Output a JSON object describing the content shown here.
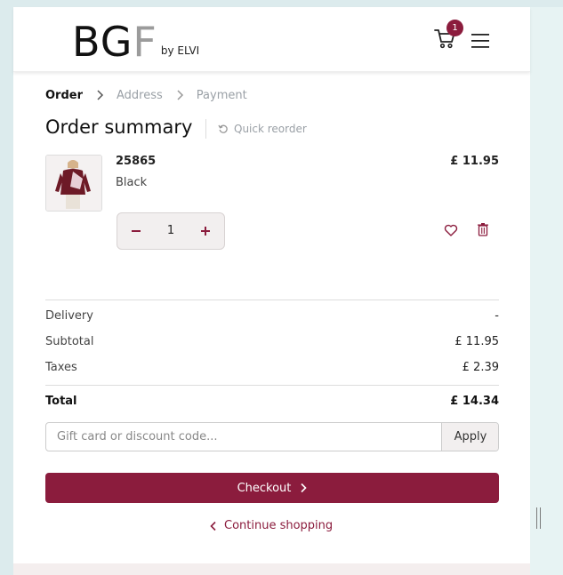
{
  "header": {
    "logo_main": "BG",
    "logo_f": "F",
    "logo_sub": "by ELVI",
    "cart_count": "1",
    "menu_icon": "hamburger-icon",
    "cart_icon": "cart-icon"
  },
  "breadcrumb": {
    "step1": "Order",
    "step2": "Address",
    "step3": "Payment"
  },
  "summary": {
    "title": "Order summary",
    "quick_reorder": "Quick reorder"
  },
  "product": {
    "name": "25865",
    "variant": "Black",
    "price": "£ 11.95",
    "quantity": "1"
  },
  "totals": {
    "delivery_label": "Delivery",
    "delivery_value": "-",
    "subtotal_label": "Subtotal",
    "subtotal_value": "£ 11.95",
    "taxes_label": "Taxes",
    "taxes_value": "£ 2.39",
    "total_label": "Total",
    "total_value": "£ 14.34"
  },
  "promo": {
    "placeholder": "Gift card or discount code...",
    "apply_label": "Apply"
  },
  "actions": {
    "checkout_label": "Checkout",
    "continue_label": "Continue shopping"
  },
  "colors": {
    "accent": "#8b1c3d",
    "background": "#dcebed"
  }
}
